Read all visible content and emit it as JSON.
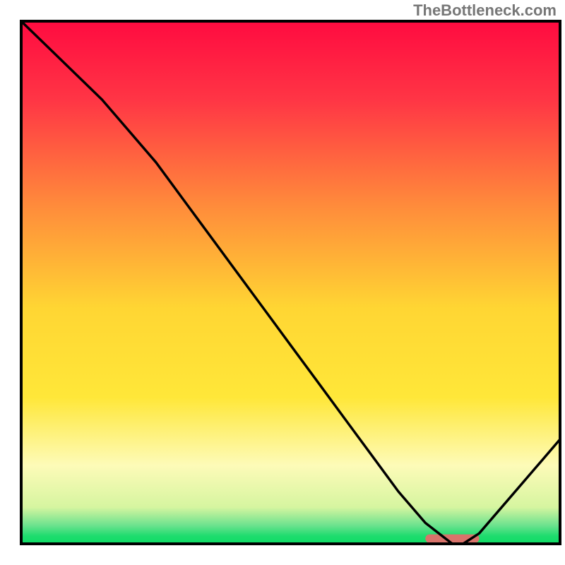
{
  "watermark": "TheBottleneck.com",
  "chart_data": {
    "type": "line",
    "title": "",
    "xlabel": "",
    "ylabel": "",
    "xlim": [
      0,
      100
    ],
    "ylim": [
      0,
      100
    ],
    "x": [
      0,
      5,
      10,
      15,
      20,
      25,
      30,
      35,
      40,
      45,
      50,
      55,
      60,
      65,
      70,
      75,
      80,
      82,
      85,
      90,
      95,
      100
    ],
    "values": [
      100,
      95,
      90,
      85,
      79,
      73,
      66,
      59,
      52,
      45,
      38,
      31,
      24,
      17,
      10,
      4,
      0,
      0,
      2,
      8,
      14,
      20
    ],
    "curve_color": "#000000",
    "gradient_stops": [
      {
        "offset": 0.0,
        "color": "#ff0b40"
      },
      {
        "offset": 0.15,
        "color": "#ff3545"
      },
      {
        "offset": 0.35,
        "color": "#ff8a3b"
      },
      {
        "offset": 0.55,
        "color": "#ffd633"
      },
      {
        "offset": 0.72,
        "color": "#ffe739"
      },
      {
        "offset": 0.85,
        "color": "#fdfbb8"
      },
      {
        "offset": 0.93,
        "color": "#d6f5a0"
      },
      {
        "offset": 0.965,
        "color": "#6be28e"
      },
      {
        "offset": 0.985,
        "color": "#1edc6e"
      },
      {
        "offset": 1.0,
        "color": "#0edb64"
      }
    ],
    "marker": {
      "x_start": 75,
      "x_end": 85,
      "y": 1,
      "color": "#d9736b"
    },
    "border_color": "#000000"
  }
}
